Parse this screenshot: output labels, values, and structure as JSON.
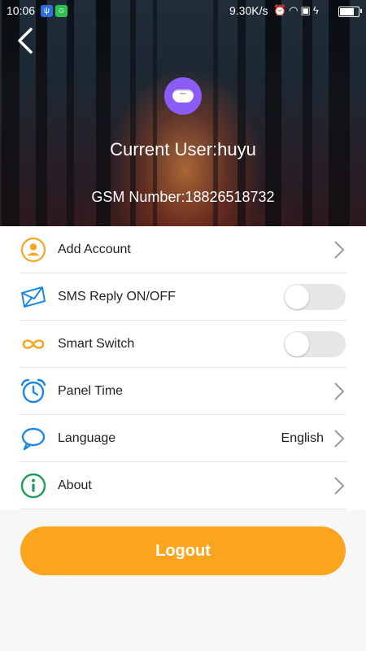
{
  "status_bar": {
    "time": "10:06",
    "speed": "9.30K/s",
    "icons": [
      "usb-icon",
      "app-icon",
      "alarm-icon",
      "wifi-icon",
      "sim-icon",
      "charging-icon",
      "battery-icon"
    ],
    "battery_level": 0.85
  },
  "header": {
    "current_user": "Current User:huyu",
    "gsm_number": "GSM Number:18826518732"
  },
  "menu": {
    "items": [
      {
        "label": "Add Account",
        "icon": "account-icon"
      },
      {
        "label": "SMS Reply ON/OFF",
        "icon": "envelope-icon",
        "toggle": false
      },
      {
        "label": "Smart Switch",
        "icon": "infinity-icon",
        "toggle": false
      },
      {
        "label": "Panel Time",
        "icon": "alarm-clock-icon"
      },
      {
        "label": "Language",
        "icon": "chat-bubble-icon",
        "value": "English"
      },
      {
        "label": "About",
        "icon": "info-icon"
      }
    ]
  },
  "logout_label": "Logout",
  "colors": {
    "accent": "#fba41d",
    "icon_orange": "#f5a623",
    "icon_blue": "#1e88e5",
    "icon_green": "#1b9e57",
    "device_purple": "#8b5cf6"
  }
}
